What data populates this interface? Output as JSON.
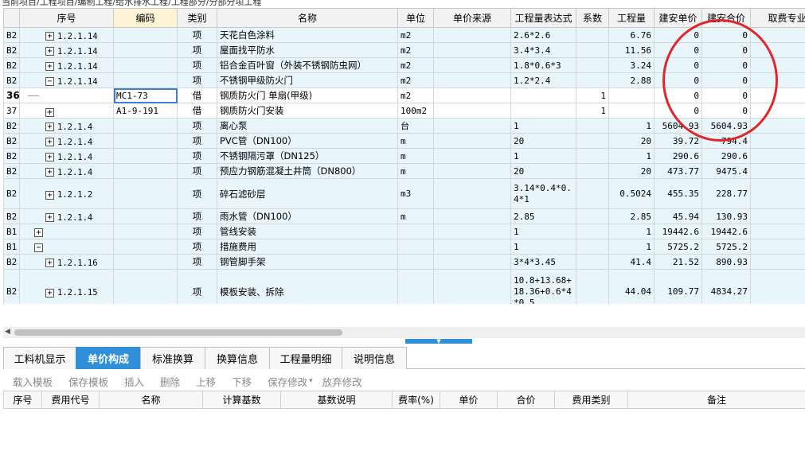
{
  "breadcrumb": "当前项目/工程项目/编制工程/给水排水工程/工程部分/分部分项工程",
  "grid": {
    "headers": [
      "",
      "序号",
      "编码",
      "类别",
      "名称",
      "单位",
      "单价来源",
      "工程量表达式",
      "系数",
      "工程量",
      "建安单价",
      "建安合价",
      "取费专业"
    ],
    "rows": [
      {
        "row": "B2",
        "seq": "1.2.1.14",
        "code": "",
        "type": "项",
        "name": "天花白色涂料",
        "unit": "m2",
        "src": "",
        "expr": "2.6*2.6",
        "coef": "",
        "qty": "6.76",
        "price": "0",
        "total": "0"
      },
      {
        "row": "B2",
        "seq": "1.2.1.14",
        "code": "",
        "type": "项",
        "name": "屋面找平防水",
        "unit": "m2",
        "src": "",
        "expr": "3.4*3.4",
        "coef": "",
        "qty": "11.56",
        "price": "0",
        "total": "0"
      },
      {
        "row": "B2",
        "seq": "1.2.1.14",
        "code": "",
        "type": "项",
        "name": "铝合金百叶窗（外装不锈钢防虫网）",
        "unit": "m2",
        "src": "",
        "expr": "1.8*0.6*3",
        "coef": "",
        "qty": "3.24",
        "price": "0",
        "total": "0"
      },
      {
        "row": "B2",
        "seq": "1.2.1.14",
        "code": "",
        "type": "项",
        "name": "不锈钢甲级防火门",
        "unit": "m2",
        "src": "",
        "expr": "1.2*2.4",
        "coef": "",
        "qty": "2.88",
        "price": "0",
        "total": "0"
      },
      {
        "row": "36",
        "seq": "",
        "code": "MC1-73",
        "type": "借",
        "name": "钢质防火门 单扇(甲级)",
        "unit": "m2",
        "src": "",
        "expr": "",
        "coef": "1",
        "qty": "",
        "price": "0",
        "total": "0"
      },
      {
        "row": "37",
        "seq": "",
        "code": "A1-9-191",
        "type": "借",
        "name": "钢质防火门安装",
        "unit": "100m2",
        "src": "",
        "expr": "",
        "coef": "1",
        "qty": "",
        "price": "0",
        "total": "0"
      },
      {
        "row": "B2",
        "seq": "1.2.1.4",
        "code": "",
        "type": "项",
        "name": "离心泵",
        "unit": "台",
        "src": "",
        "expr": "1",
        "coef": "",
        "qty": "1",
        "price": "5604.93",
        "total": "5604.93"
      },
      {
        "row": "B2",
        "seq": "1.2.1.4",
        "code": "",
        "type": "项",
        "name": "PVC管（DN100）",
        "unit": "m",
        "src": "",
        "expr": "20",
        "coef": "",
        "qty": "20",
        "price": "39.72",
        "total": "794.4"
      },
      {
        "row": "B2",
        "seq": "1.2.1.4",
        "code": "",
        "type": "项",
        "name": "不锈钢隔污罩（DN125）",
        "unit": "m",
        "src": "",
        "expr": "1",
        "coef": "",
        "qty": "1",
        "price": "290.6",
        "total": "290.6"
      },
      {
        "row": "B2",
        "seq": "1.2.1.4",
        "code": "",
        "type": "项",
        "name": "预应力钢筋混凝土井筒（DN800）",
        "unit": "m",
        "src": "",
        "expr": "20",
        "coef": "",
        "qty": "20",
        "price": "473.77",
        "total": "9475.4"
      },
      {
        "row": "B2",
        "seq": "1.2.1.2",
        "code": "",
        "type": "项",
        "name": "碎石滤砂层",
        "unit": "m3",
        "src": "",
        "expr": "3.14*0.4*0.4*1",
        "coef": "",
        "qty": "0.5024",
        "price": "455.35",
        "total": "228.77"
      },
      {
        "row": "B2",
        "seq": "1.2.1.4",
        "code": "",
        "type": "项",
        "name": "雨水管（DN100）",
        "unit": "m",
        "src": "",
        "expr": "2.85",
        "coef": "",
        "qty": "2.85",
        "price": "45.94",
        "total": "130.93"
      },
      {
        "row": "B1",
        "seq": "",
        "code": "",
        "type": "项",
        "name": "管线安装",
        "unit": "",
        "src": "",
        "expr": "1",
        "coef": "",
        "qty": "1",
        "price": "19442.6",
        "total": "19442.6"
      },
      {
        "row": "B1",
        "seq": "",
        "code": "",
        "type": "项",
        "name": "措施费用",
        "unit": "",
        "src": "",
        "expr": "1",
        "coef": "",
        "qty": "1",
        "price": "5725.2",
        "total": "5725.2"
      },
      {
        "row": "B2",
        "seq": "1.2.1.16",
        "code": "",
        "type": "项",
        "name": "钢管脚手架",
        "unit": "",
        "src": "",
        "expr": "3*4*3.45",
        "coef": "",
        "qty": "41.4",
        "price": "21.52",
        "total": "890.93"
      },
      {
        "row": "B2",
        "seq": "1.2.1.15",
        "code": "",
        "type": "项",
        "name": "模板安装、拆除",
        "unit": "",
        "src": "",
        "expr": "10.8+13.68+18.36+0.6*4*0.5",
        "coef": "",
        "qty": "44.04",
        "price": "109.77",
        "total": "4834.27"
      }
    ]
  },
  "tabs": [
    "工料机显示",
    "单价构成",
    "标准换算",
    "换算信息",
    "工程量明细",
    "说明信息"
  ],
  "toolbar": [
    "载入模板",
    "保存模板",
    "插入",
    "删除",
    "上移",
    "下移",
    "保存修改",
    "放弃修改"
  ],
  "sub_headers": [
    "序号",
    "费用代号",
    "名称",
    "计算基数",
    "基数说明",
    "费率(%)",
    "单价",
    "合价",
    "费用类别",
    "备注"
  ],
  "colors": {
    "accent": "#2f8fd8",
    "annotation": "#e0262a",
    "row_bg": "#e8f6fb"
  },
  "icons": {
    "expand": "plus-box-icon",
    "collapse": "minus-box-icon",
    "splitter": "chevron-down-icon",
    "scroll": "arrow-left-icon"
  }
}
